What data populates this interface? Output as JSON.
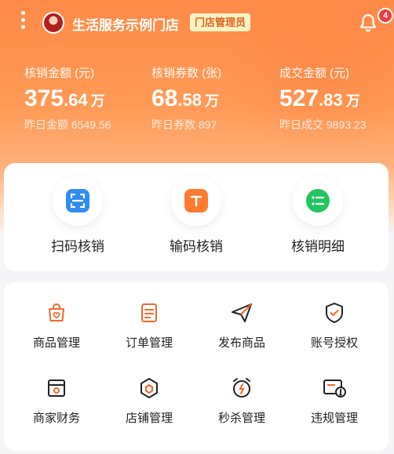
{
  "header": {
    "store_name": "生活服务示例门店",
    "role_badge": "门店管理员",
    "notification_count": "4"
  },
  "stats": [
    {
      "label": "核销金额 (元)",
      "value_int": "375",
      "value_dec": ".64",
      "unit": "万",
      "sub": "昨日金额 6549.56"
    },
    {
      "label": "核销券数 (张)",
      "value_int": "68",
      "value_dec": ".58",
      "unit": "万",
      "sub": "昨日券数 897"
    },
    {
      "label": "成交金额 (元)",
      "value_int": "527",
      "value_dec": ".83",
      "unit": "万",
      "sub": "昨日成交 9893.23"
    }
  ],
  "actions": [
    {
      "label": "扫码核销",
      "icon": "scan-icon",
      "color": "#2f8cf0"
    },
    {
      "label": "输码核销",
      "icon": "keyboard-t-icon",
      "color": "#ff7a2f"
    },
    {
      "label": "核销明细",
      "icon": "list-detail-icon",
      "color": "#22c55e"
    }
  ],
  "grid": [
    {
      "label": "商品管理",
      "icon": "shopping-bag-icon"
    },
    {
      "label": "订单管理",
      "icon": "order-list-icon"
    },
    {
      "label": "发布商品",
      "icon": "paper-plane-icon"
    },
    {
      "label": "账号授权",
      "icon": "shield-check-icon"
    },
    {
      "label": "商家财务",
      "icon": "finance-shop-icon"
    },
    {
      "label": "店铺管理",
      "icon": "hexagon-store-icon"
    },
    {
      "label": "秒杀管理",
      "icon": "alarm-clock-icon"
    },
    {
      "label": "违规管理",
      "icon": "violation-card-icon"
    }
  ],
  "colors": {
    "accent": "#ff8a47",
    "icon_orange": "#f06a2a",
    "badge_red": "#f23b3b"
  }
}
